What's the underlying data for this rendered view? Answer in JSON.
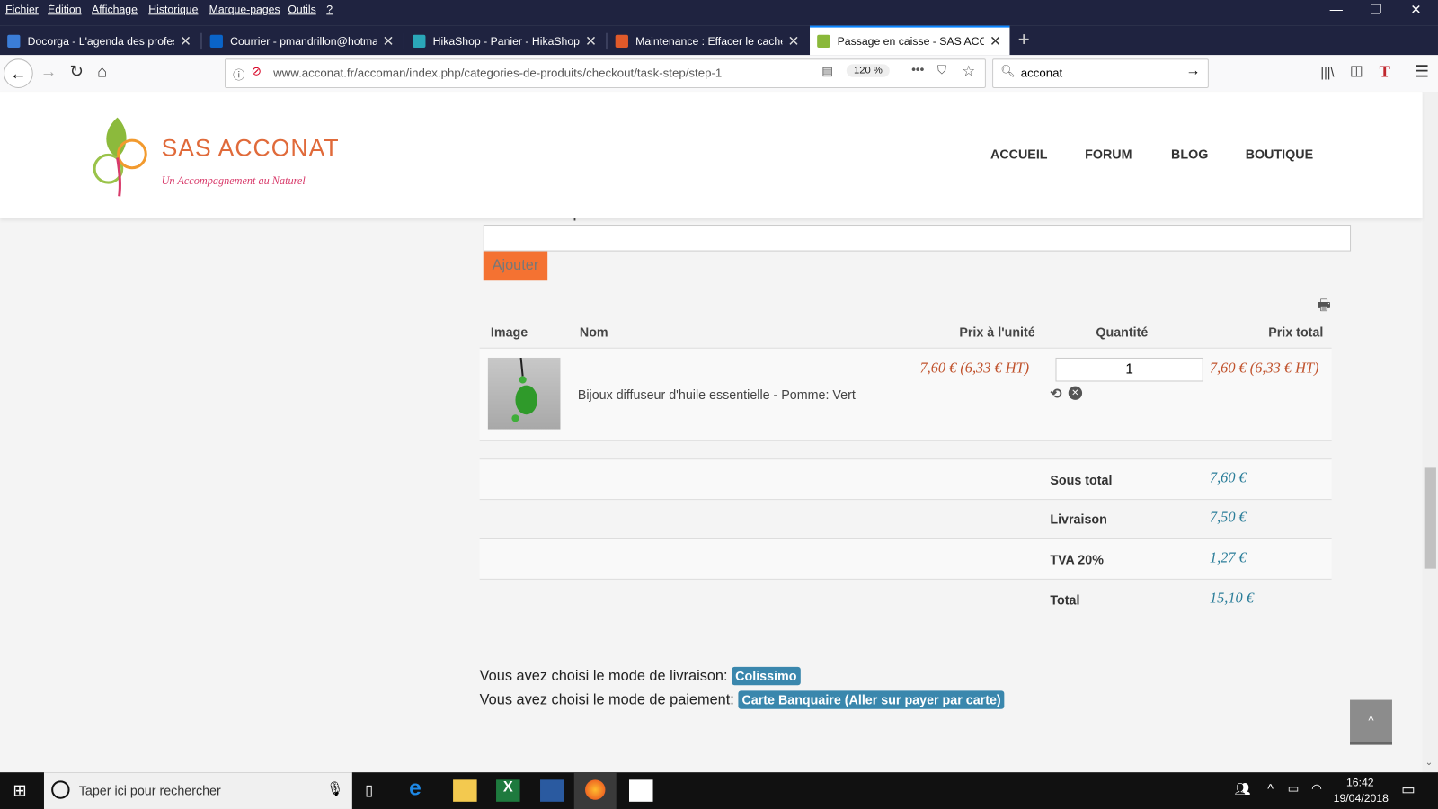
{
  "browser": {
    "menu": [
      "Fichier",
      "Édition",
      "Affichage",
      "Historique",
      "Marque-pages",
      "Outils",
      "?"
    ],
    "tabs": [
      {
        "title": "Docorga - L'agenda des profess",
        "active": false,
        "color": "#3b7dd8"
      },
      {
        "title": "Courrier - pmandrillon@hotma",
        "active": false,
        "color": "#0a64c8"
      },
      {
        "title": "HikaShop - Panier - HikaShop",
        "active": false,
        "color": "#2aa7b8"
      },
      {
        "title": "Maintenance : Effacer le cache",
        "active": false,
        "color": "#e05a2a"
      },
      {
        "title": "Passage en caisse - SAS ACCON",
        "active": true,
        "color": "#8ab83a"
      }
    ],
    "url": "www.acconat.fr/accoman/index.php/categories-de-produits/checkout/task-step/step-1",
    "zoom": "120 %",
    "search_value": "acconat"
  },
  "site": {
    "logo_title": "SAS ACCONAT",
    "logo_tagline": "Un Accompagnement au Naturel",
    "nav": [
      "ACCUEIL",
      "FORUM",
      "BLOG",
      "BOUTIQUE"
    ]
  },
  "coupon": {
    "label": "Entrez votre coupon",
    "value": "",
    "button": "Ajouter"
  },
  "cart": {
    "headers": {
      "image": "Image",
      "name": "Nom",
      "unit_price": "Prix à l'unité",
      "quantity": "Quantité",
      "total": "Prix total"
    },
    "items": [
      {
        "name": "Bijoux diffuseur d'huile essentielle - Pomme: Vert",
        "unit_price": "7,60 € (6,33 € HT)",
        "quantity": "1",
        "total": "7,60 € (6,33 € HT)"
      }
    ],
    "totals": [
      {
        "label": "Sous total",
        "value": "7,60 €"
      },
      {
        "label": "Livraison",
        "value": "7,50 €"
      },
      {
        "label": "TVA 20%",
        "value": "1,27 €"
      },
      {
        "label": "Total",
        "value": "15,10 €"
      }
    ]
  },
  "shipping": {
    "text": "Vous avez choisi le mode de livraison:",
    "value": "Colissimo"
  },
  "payment": {
    "text": "Vous avez choisi le mode de paiement:",
    "value": "Carte Banquaire (Aller sur payer par carte)"
  },
  "taskbar": {
    "search_placeholder": "Taper ici pour rechercher",
    "time": "16:42",
    "date": "19/04/2018"
  },
  "colors": {
    "accent_orange": "#f47232",
    "price_red": "#c0522c",
    "total_teal": "#2a7d99",
    "badge_blue": "#3a87ad"
  }
}
